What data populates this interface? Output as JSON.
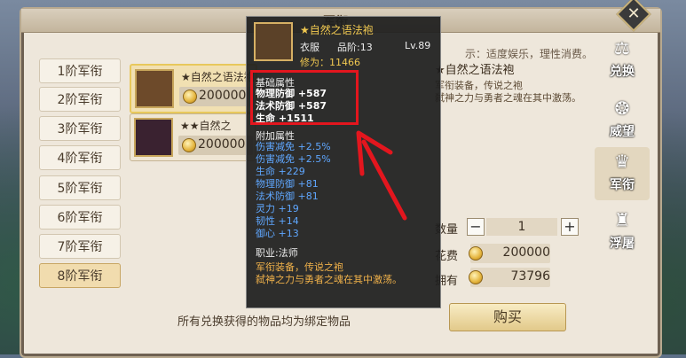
{
  "window": {
    "title": "军衔"
  },
  "notice": "示：适度娱乐，理性消费。",
  "tiers": [
    "1阶军衔",
    "2阶军衔",
    "3阶军衔",
    "4阶军衔",
    "5阶军衔",
    "6阶军衔",
    "7阶军衔",
    "8阶军衔"
  ],
  "items": [
    {
      "name": "★自然之语法袍",
      "price": "200000"
    },
    {
      "name": "★★自然之",
      "price": "200000"
    }
  ],
  "detail": {
    "name": "★自然之语法袍",
    "desc": "军衔装备，传说之袍\n弑神之力与勇者之魂在其中激荡。"
  },
  "purchase": {
    "qty_label": "数量",
    "qty_value": "1",
    "minus": "−",
    "plus": "+",
    "cost_label": "花费",
    "cost_value": "200000",
    "own_label": "拥有",
    "own_value": "73796",
    "buy_label": "购买"
  },
  "footnote": "所有兑换获得的物品均为绑定物品",
  "sidebar": [
    {
      "label": "兑换",
      "icon": "scale-icon",
      "glyph": "⚖"
    },
    {
      "label": "威望",
      "icon": "prestige-icon",
      "glyph": "❂"
    },
    {
      "label": "军衔",
      "icon": "helmet-icon",
      "glyph": "♛"
    },
    {
      "label": "浮屠",
      "icon": "pagoda-icon",
      "glyph": "♜"
    }
  ],
  "tooltip": {
    "name": "★自然之语法袍",
    "type": "衣服",
    "grade": "品阶:13",
    "level": "Lv.89",
    "cultivation": "修为：11466",
    "basic_title": "基础属性",
    "basic_stats": [
      "物理防御 +587",
      "法术防御 +587",
      "生命 +1511"
    ],
    "extra_title": "附加属性",
    "extra_stats": [
      "伤害减免 +2.5%",
      "伤害减免 +2.5%",
      "生命 +229",
      "物理防御 +81",
      "法术防御 +81",
      "灵力 +19",
      "韧性 +14",
      "御心 +13"
    ],
    "job": "职业:法师",
    "desc": "军衔装备，传说之袍\n弑神之力与勇者之魂在其中激荡。"
  },
  "colors": {
    "highlight": "#e3161e",
    "gold_text": "#f0c850",
    "blue_stat": "#5fa7ff"
  }
}
